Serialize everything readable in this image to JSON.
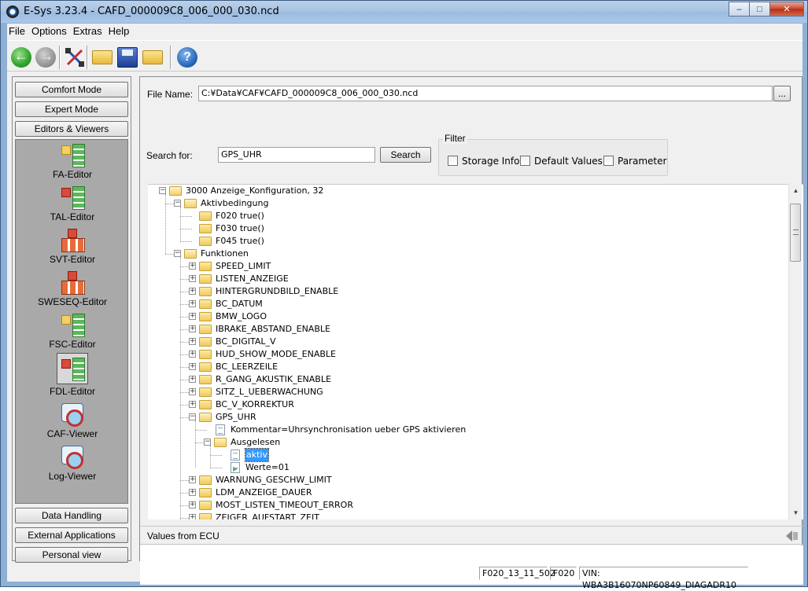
{
  "window": {
    "title": "E-Sys 3.23.4 - CAFD_000009C8_006_000_030.ncd",
    "buttons": {
      "minimize": "–",
      "maximize": "□",
      "close": "✕"
    }
  },
  "menu": [
    "File",
    "Options",
    "Extras",
    "Help"
  ],
  "toolbar": {
    "icons": [
      "back-icon",
      "forward-icon",
      "connect-icon",
      "open-folder-icon",
      "save-icon",
      "open-file-icon",
      "help-icon"
    ],
    "help_glyph": "?"
  },
  "sidebar": {
    "top_buttons": [
      "Comfort Mode",
      "Expert Mode",
      "Editors & Viewers"
    ],
    "editors": [
      "FA-Editor",
      "TAL-Editor",
      "SVT-Editor",
      "SWESEQ-Editor",
      "FSC-Editor",
      "FDL-Editor",
      "CAF-Viewer",
      "Log-Viewer"
    ],
    "selected_editor": "FDL-Editor",
    "bottom_buttons": [
      "Data Handling",
      "External Applications",
      "Personal view"
    ]
  },
  "main": {
    "file_name_label": "File Name:",
    "file_name_value": "C:¥Data¥CAF¥CAFD_000009C8_006_000_030.ncd",
    "browse_label": "...",
    "search_label": "Search for:",
    "search_value": "GPS_UHR",
    "search_button": "Search",
    "filter": {
      "title": "Filter",
      "options": [
        {
          "label": "Storage Info",
          "checked": false
        },
        {
          "label": "Default Values",
          "checked": false
        },
        {
          "label": "Parameter",
          "checked": false
        }
      ]
    },
    "tree": [
      {
        "text": "3000 Anzeige_Konfiguration, 32",
        "level": 0,
        "type": "folder",
        "expander": "minus"
      },
      {
        "text": "Aktivbedingung",
        "level": 1,
        "type": "folder",
        "expander": "minus"
      },
      {
        "text": "F020 true()",
        "level": 2,
        "type": "folder",
        "expander": ""
      },
      {
        "text": "F030 true()",
        "level": 2,
        "type": "folder",
        "expander": ""
      },
      {
        "text": "F045 true()",
        "level": 2,
        "type": "folder",
        "expander": ""
      },
      {
        "text": "Funktionen",
        "level": 1,
        "type": "folder",
        "expander": "minus"
      },
      {
        "text": "SPEED_LIMIT",
        "level": 2,
        "type": "folder",
        "expander": "plus"
      },
      {
        "text": "LISTEN_ANZEIGE",
        "level": 2,
        "type": "folder",
        "expander": "plus"
      },
      {
        "text": "HINTERGRUNDBILD_ENABLE",
        "level": 2,
        "type": "folder",
        "expander": "plus"
      },
      {
        "text": "BC_DATUM",
        "level": 2,
        "type": "folder",
        "expander": "plus"
      },
      {
        "text": "BMW_LOGO",
        "level": 2,
        "type": "folder",
        "expander": "plus"
      },
      {
        "text": "IBRAKE_ABSTAND_ENABLE",
        "level": 2,
        "type": "folder",
        "expander": "plus"
      },
      {
        "text": "BC_DIGITAL_V",
        "level": 2,
        "type": "folder",
        "expander": "plus"
      },
      {
        "text": "HUD_SHOW_MODE_ENABLE",
        "level": 2,
        "type": "folder",
        "expander": "plus"
      },
      {
        "text": "BC_LEERZEILE",
        "level": 2,
        "type": "folder",
        "expander": "plus"
      },
      {
        "text": "R_GANG_AKUSTIK_ENABLE",
        "level": 2,
        "type": "folder",
        "expander": "plus"
      },
      {
        "text": "SITZ_L_UEBERWACHUNG",
        "level": 2,
        "type": "folder",
        "expander": "plus"
      },
      {
        "text": "BC_V_KORREKTUR",
        "level": 2,
        "type": "folder",
        "expander": "plus"
      },
      {
        "text": "GPS_UHR",
        "level": 2,
        "type": "folder",
        "expander": "minus"
      },
      {
        "text": "Kommentar=Uhrsynchronisation ueber GPS aktivieren",
        "level": 3,
        "type": "doc",
        "expander": ""
      },
      {
        "text": "Ausgelesen",
        "level": 3,
        "type": "folder",
        "expander": "minus"
      },
      {
        "text": "aktiv",
        "level": 4,
        "type": "doc",
        "expander": "",
        "selected": true
      },
      {
        "text": "Werte=01",
        "level": 4,
        "type": "leaf",
        "expander": ""
      },
      {
        "text": "WARNUNG_GESCHW_LIMIT",
        "level": 2,
        "type": "folder",
        "expander": "plus"
      },
      {
        "text": "LDM_ANZEIGE_DAUER",
        "level": 2,
        "type": "folder",
        "expander": "plus"
      },
      {
        "text": "MOST_LISTEN_TIMEOUT_ERROR",
        "level": 2,
        "type": "folder",
        "expander": "plus"
      },
      {
        "text": "ZEIGER_AUFSTART_ZEIT",
        "level": 2,
        "type": "folder",
        "expander": "plus"
      }
    ],
    "values_from_ecu_label": "Values from ECU"
  },
  "status": {
    "cells": [
      "F020_13_11_502",
      "F020",
      "VIN: WBA3B16070NP60849_DIAGADR10"
    ]
  }
}
